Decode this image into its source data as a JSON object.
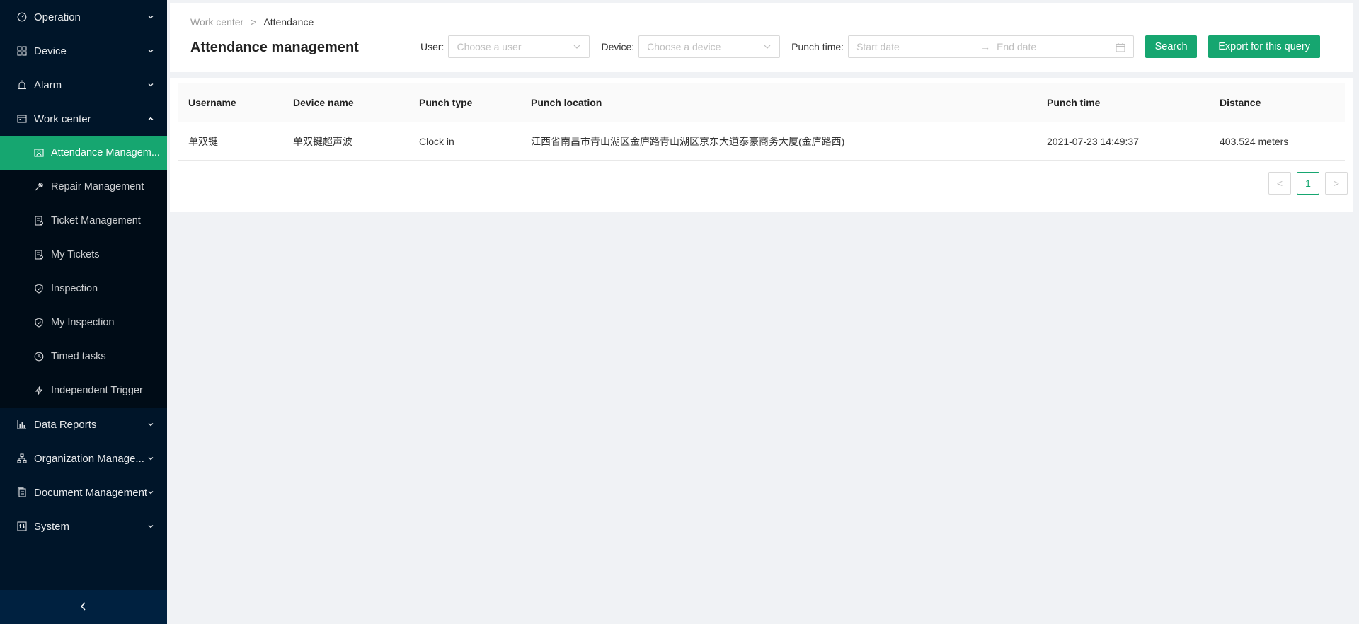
{
  "sidebar": {
    "top_items": [
      {
        "label": "Operation",
        "icon": "dashboard-icon"
      },
      {
        "label": "Device",
        "icon": "grid-icon"
      },
      {
        "label": "Alarm",
        "icon": "alarm-icon"
      },
      {
        "label": "Work center",
        "icon": "workcenter-icon"
      }
    ],
    "work_center_items": [
      {
        "label": "Attendance Managem...",
        "icon": "attendance-icon"
      },
      {
        "label": "Repair Management",
        "icon": "wrench-icon"
      },
      {
        "label": "Ticket Management",
        "icon": "ticket-icon"
      },
      {
        "label": "My Tickets",
        "icon": "ticket-icon"
      },
      {
        "label": "Inspection",
        "icon": "shield-icon"
      },
      {
        "label": "My Inspection",
        "icon": "shield-icon"
      },
      {
        "label": "Timed tasks",
        "icon": "clock-icon"
      },
      {
        "label": "Independent Trigger",
        "icon": "lightning-icon"
      }
    ],
    "bottom_items": [
      {
        "label": "Data Reports",
        "icon": "bar-chart-icon"
      },
      {
        "label": "Organization Manage...",
        "icon": "org-icon"
      },
      {
        "label": "Document Management",
        "icon": "document-icon"
      },
      {
        "label": "System",
        "icon": "system-icon"
      }
    ],
    "collapse_icon": "chevron-left-icon"
  },
  "breadcrumb": {
    "parent": "Work center",
    "separator": ">",
    "current": "Attendance"
  },
  "page_title": "Attendance management",
  "filters": {
    "user_label": "User:",
    "user_placeholder": "Choose a user",
    "device_label": "Device:",
    "device_placeholder": "Choose a device",
    "punch_time_label": "Punch time:",
    "start_placeholder": "Start date",
    "range_arrow": "→",
    "end_placeholder": "End date",
    "search_label": "Search",
    "export_label": "Export for this query"
  },
  "table": {
    "columns": [
      "Username",
      "Device name",
      "Punch type",
      "Punch location",
      "Punch time",
      "Distance"
    ],
    "rows": [
      [
        "单双键",
        "单双键超声波",
        "Clock in",
        "江西省南昌市青山湖区金庐路青山湖区京东大道泰豪商务大厦(金庐路西)",
        "2021-07-23 14:49:37",
        "403.524 meters"
      ]
    ]
  },
  "pagination": {
    "prev": "<",
    "current_page": "1",
    "next": ">"
  },
  "colors": {
    "accent": "#16a670",
    "sidebar_bg": "#001529",
    "submenu_bg": "#000c17"
  }
}
